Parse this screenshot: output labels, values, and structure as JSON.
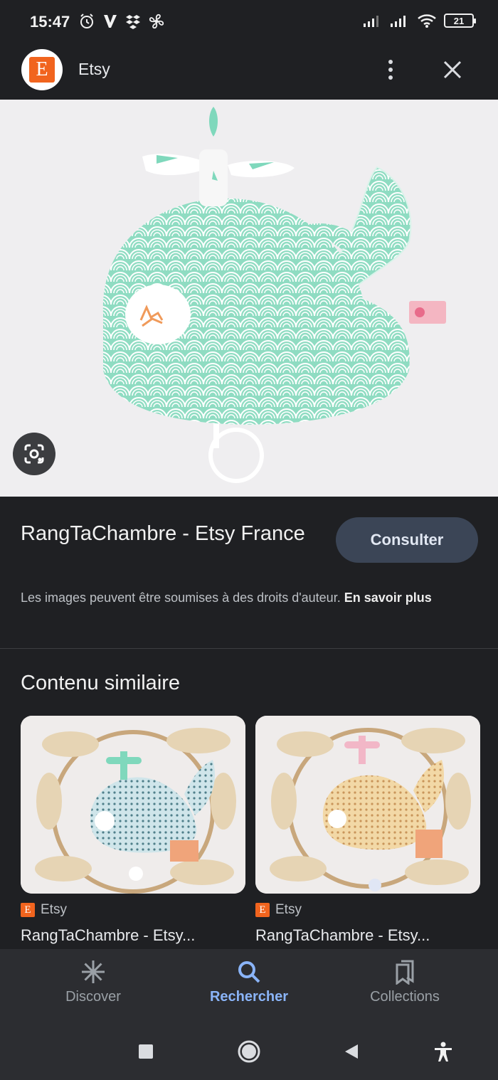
{
  "status_bar": {
    "time": "15:47",
    "battery": "21",
    "icons_left": [
      "alarm-icon",
      "v-app-icon",
      "dropbox-icon",
      "fan-icon"
    ],
    "icons_right": [
      "signal-icon",
      "signal-icon",
      "wifi-icon",
      "battery-icon"
    ]
  },
  "app_bar": {
    "logo_letter": "E",
    "title": "Etsy"
  },
  "result": {
    "title": "RangTaChambre - Etsy France",
    "visit_label": "Consulter",
    "copyright_text": "Les images peuvent être soumises à des droits d'auteur.",
    "learn_more": "En savoir plus"
  },
  "similar": {
    "heading": "Contenu similaire",
    "cards": [
      {
        "source_letter": "E",
        "source": "Etsy",
        "title": "RangTaChambre - Etsy..."
      },
      {
        "source_letter": "E",
        "source": "Etsy",
        "title": "RangTaChambre - Etsy..."
      }
    ]
  },
  "bottom_nav": {
    "items": [
      {
        "label": "Discover"
      },
      {
        "label": "Rechercher"
      },
      {
        "label": "Collections"
      }
    ]
  },
  "colors": {
    "background": "#1f2023",
    "accent": "#8ab4f8",
    "button": "#3b4556",
    "etsy_orange": "#f1641e",
    "whale_mint": "#a8e6d3"
  }
}
